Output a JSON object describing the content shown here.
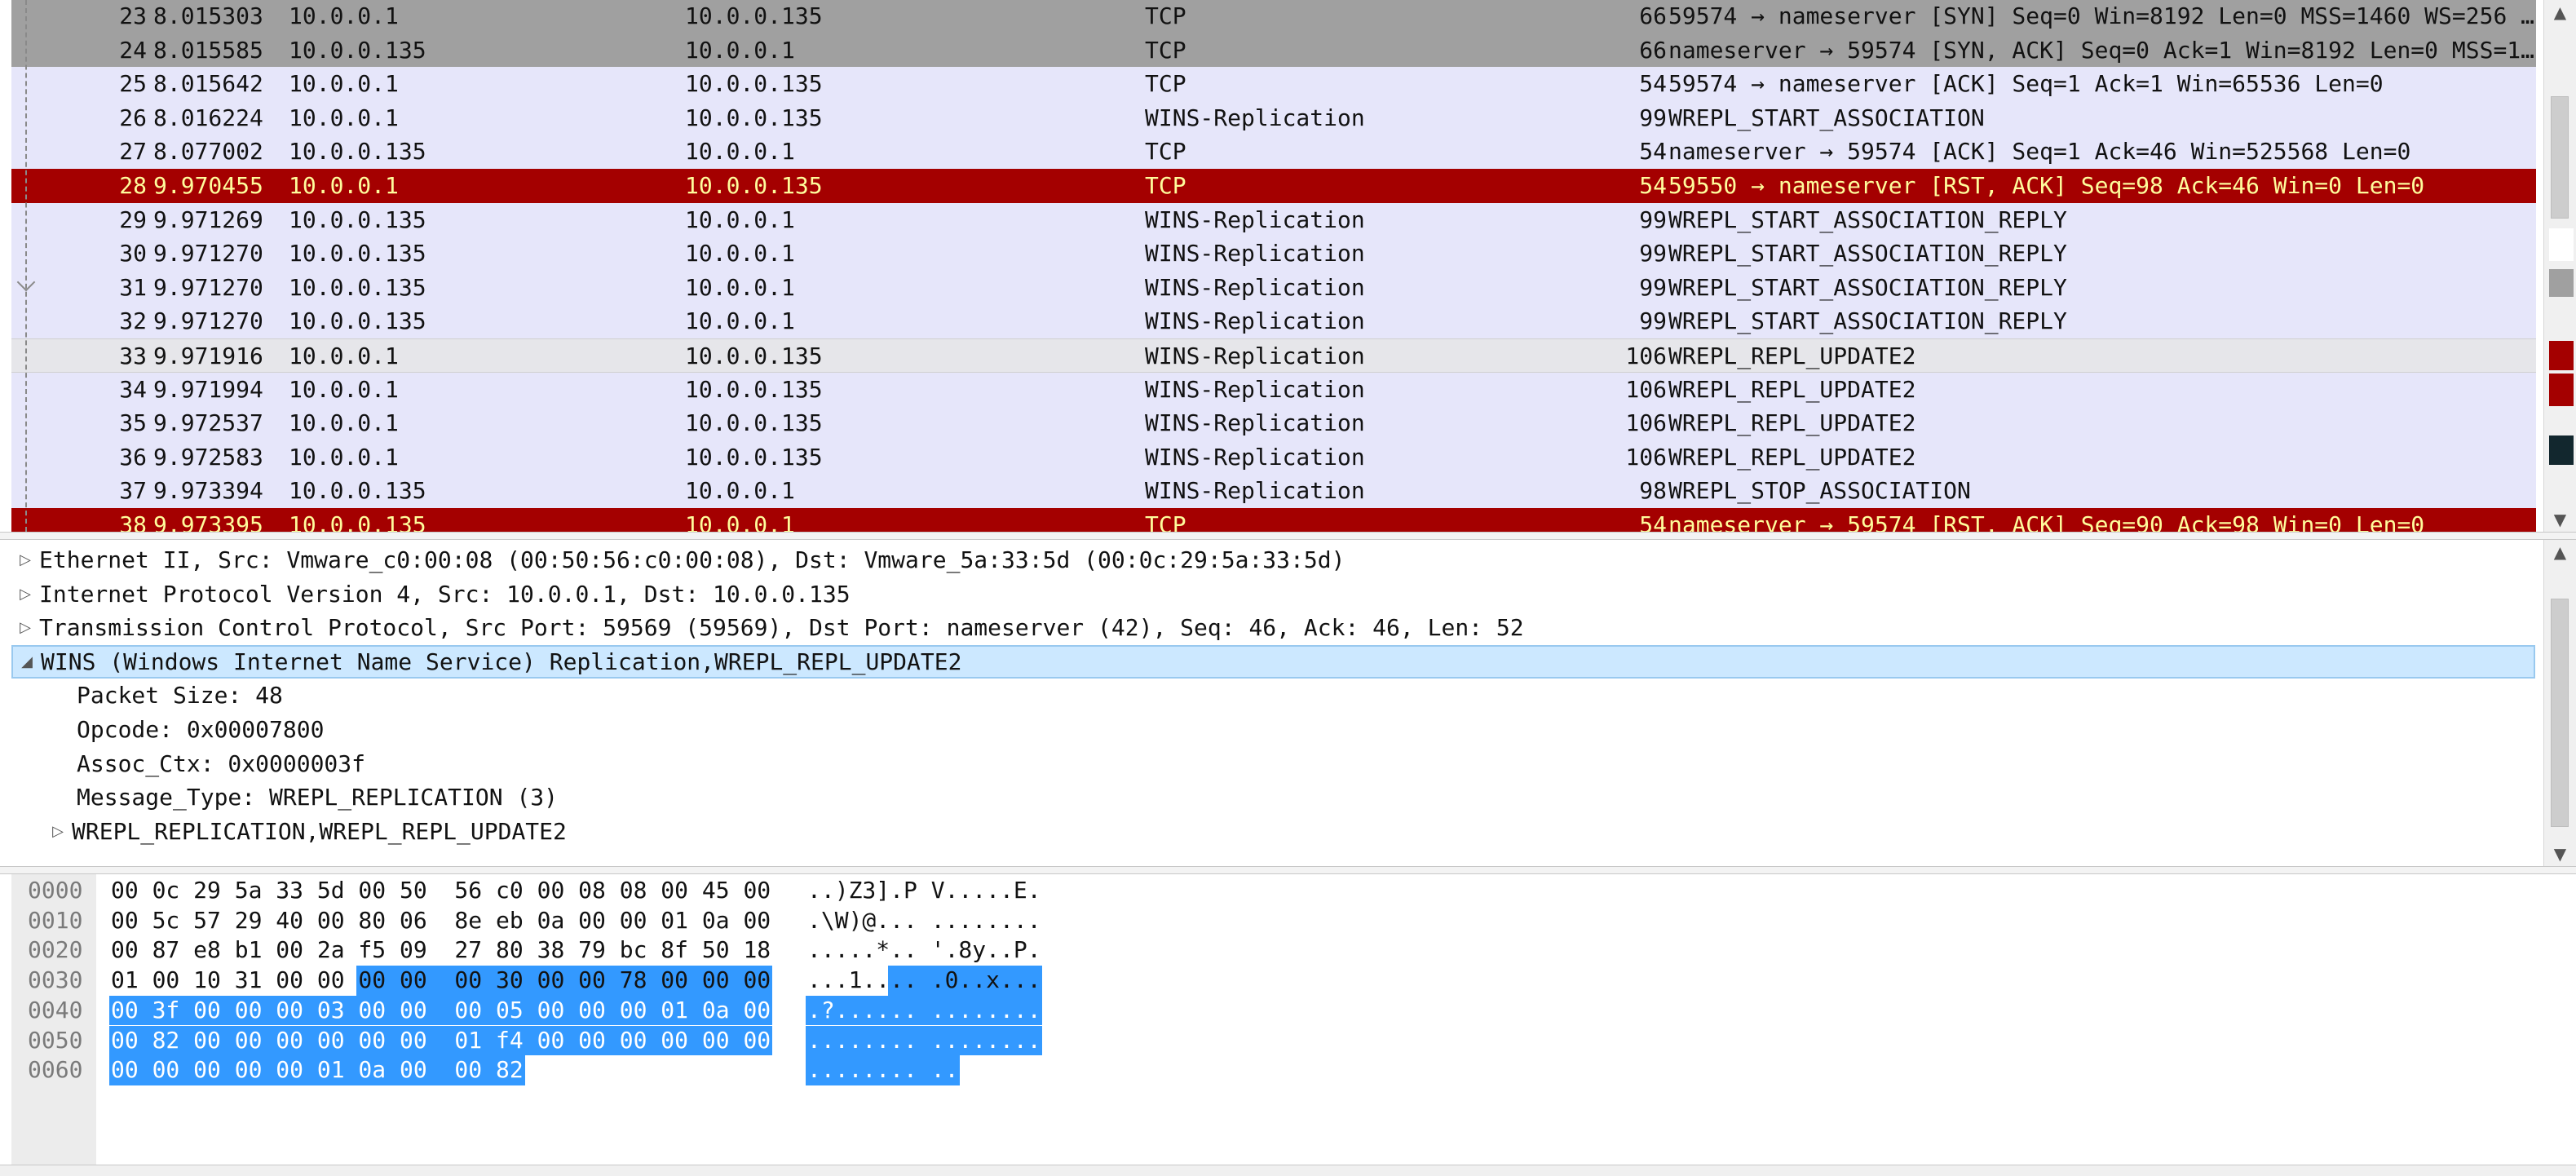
{
  "packet_list": {
    "rows": [
      {
        "no": "23",
        "time": "8.015303",
        "src": "10.0.0.1",
        "dst": "10.0.0.135",
        "proto": "TCP",
        "len": "66",
        "info": "59574 → nameserver [SYN] Seq=0 Win=8192 Len=0 MSS=1460 WS=256 …",
        "style": "gray"
      },
      {
        "no": "24",
        "time": "8.015585",
        "src": "10.0.0.135",
        "dst": "10.0.0.1",
        "proto": "TCP",
        "len": "66",
        "info": "nameserver → 59574 [SYN, ACK] Seq=0 Ack=1 Win=8192 Len=0 MSS=1…",
        "style": "gray"
      },
      {
        "no": "25",
        "time": "8.015642",
        "src": "10.0.0.1",
        "dst": "10.0.0.135",
        "proto": "TCP",
        "len": "54",
        "info": "59574 → nameserver [ACK] Seq=1 Ack=1 Win=65536 Len=0",
        "style": "normal"
      },
      {
        "no": "26",
        "time": "8.016224",
        "src": "10.0.0.1",
        "dst": "10.0.0.135",
        "proto": "WINS-Replication",
        "len": "99",
        "info": "WREPL_START_ASSOCIATION",
        "style": "normal"
      },
      {
        "no": "27",
        "time": "8.077002",
        "src": "10.0.0.135",
        "dst": "10.0.0.1",
        "proto": "TCP",
        "len": "54",
        "info": "nameserver → 59574 [ACK] Seq=1 Ack=46 Win=525568 Len=0",
        "style": "normal"
      },
      {
        "no": "28",
        "time": "9.970455",
        "src": "10.0.0.1",
        "dst": "10.0.0.135",
        "proto": "TCP",
        "len": "54",
        "info": "59550 → nameserver [RST, ACK] Seq=98 Ack=46 Win=0 Len=0",
        "style": "red"
      },
      {
        "no": "29",
        "time": "9.971269",
        "src": "10.0.0.135",
        "dst": "10.0.0.1",
        "proto": "WINS-Replication",
        "len": "99",
        "info": "WREPL_START_ASSOCIATION_REPLY",
        "style": "normal"
      },
      {
        "no": "30",
        "time": "9.971270",
        "src": "10.0.0.135",
        "dst": "10.0.0.1",
        "proto": "WINS-Replication",
        "len": "99",
        "info": "WREPL_START_ASSOCIATION_REPLY",
        "style": "normal"
      },
      {
        "no": "31",
        "time": "9.971270",
        "src": "10.0.0.135",
        "dst": "10.0.0.1",
        "proto": "WINS-Replication",
        "len": "99",
        "info": "WREPL_START_ASSOCIATION_REPLY",
        "style": "normal"
      },
      {
        "no": "32",
        "time": "9.971270",
        "src": "10.0.0.135",
        "dst": "10.0.0.1",
        "proto": "WINS-Replication",
        "len": "99",
        "info": "WREPL_START_ASSOCIATION_REPLY",
        "style": "normal"
      },
      {
        "no": "33",
        "time": "9.971916",
        "src": "10.0.0.1",
        "dst": "10.0.0.135",
        "proto": "WINS-Replication",
        "len": "106",
        "info": "WREPL_REPL_UPDATE2",
        "style": "hover"
      },
      {
        "no": "34",
        "time": "9.971994",
        "src": "10.0.0.1",
        "dst": "10.0.0.135",
        "proto": "WINS-Replication",
        "len": "106",
        "info": "WREPL_REPL_UPDATE2",
        "style": "normal"
      },
      {
        "no": "35",
        "time": "9.972537",
        "src": "10.0.0.1",
        "dst": "10.0.0.135",
        "proto": "WINS-Replication",
        "len": "106",
        "info": "WREPL_REPL_UPDATE2",
        "style": "normal"
      },
      {
        "no": "36",
        "time": "9.972583",
        "src": "10.0.0.1",
        "dst": "10.0.0.135",
        "proto": "WINS-Replication",
        "len": "106",
        "info": "WREPL_REPL_UPDATE2",
        "style": "normal"
      },
      {
        "no": "37",
        "time": "9.973394",
        "src": "10.0.0.135",
        "dst": "10.0.0.1",
        "proto": "WINS-Replication",
        "len": "98",
        "info": "WREPL_STOP_ASSOCIATION",
        "style": "normal"
      },
      {
        "no": "38",
        "time": "9.973395",
        "src": "10.0.0.135",
        "dst": "10.0.0.1",
        "proto": "TCP",
        "len": "54",
        "info": "nameserver → 59574 [RST, ACK] Seq=90 Ack=98 Win=0 Len=0",
        "style": "red"
      }
    ],
    "minimap_colors": [
      "#a40000",
      "#a40000",
      "#12272e",
      "#a0a0a0",
      "#ffffff"
    ]
  },
  "details": {
    "items": [
      {
        "text": "Ethernet II, Src: Vmware_c0:00:08 (00:50:56:c0:00:08), Dst: Vmware_5a:33:5d (00:0c:29:5a:33:5d)",
        "level": 0,
        "state": "collapsed"
      },
      {
        "text": "Internet Protocol Version 4, Src: 10.0.0.1, Dst: 10.0.0.135",
        "level": 0,
        "state": "collapsed"
      },
      {
        "text": "Transmission Control Protocol, Src Port: 59569 (59569), Dst Port: nameserver (42), Seq: 46, Ack: 46, Len: 52",
        "level": 0,
        "state": "collapsed"
      },
      {
        "text": "WINS (Windows Internet Name Service) Replication,WREPL_REPL_UPDATE2",
        "level": 0,
        "state": "expanded",
        "selected": true
      },
      {
        "text": "Packet Size: 48",
        "level": 1,
        "state": "leaf"
      },
      {
        "text": "Opcode: 0x00007800",
        "level": 1,
        "state": "leaf"
      },
      {
        "text": "Assoc_Ctx: 0x0000003f",
        "level": 1,
        "state": "leaf"
      },
      {
        "text": "Message_Type: WREPL_REPLICATION (3)",
        "level": 1,
        "state": "leaf"
      },
      {
        "text": "WREPL_REPLICATION,WREPL_REPL_UPDATE2",
        "level": 1,
        "state": "collapsed"
      }
    ]
  },
  "bytes": {
    "rows": [
      {
        "offset": "0000",
        "hex": "00 0c 29 5a 33 5d 00 50  56 c0 00 08 08 00 45 00",
        "ascii": "..)Z3].P V.....E."
      },
      {
        "offset": "0010",
        "hex": "00 5c 57 29 40 00 80 06  8e eb 0a 00 00 01 0a 00",
        "ascii": ".\\W)@... ........"
      },
      {
        "offset": "0020",
        "hex": "00 87 e8 b1 00 2a f5 09  27 80 38 79 bc 8f 50 18",
        "ascii": ".....*.. '.8y..P."
      },
      {
        "offset": "0030",
        "hex": "01 00 10 31 00 00 00 00  00 30 00 00 78 00 00 00",
        "ascii": "...1.... .0..x..."
      },
      {
        "offset": "0040",
        "hex": "00 3f 00 00 00 03 00 00  00 05 00 00 00 01 0a 00",
        "ascii": ".?...... ........"
      },
      {
        "offset": "0050",
        "hex": "00 82 00 00 00 00 00 00  01 f4 00 00 00 00 00 00",
        "ascii": "........ ........"
      },
      {
        "offset": "0060",
        "hex": "00 00 00 00 00 01 0a 00  00 82",
        "ascii": "........ .."
      }
    ],
    "selection_start_byte": 54,
    "selection_length": 52,
    "highlight_color": "#3399ff"
  }
}
